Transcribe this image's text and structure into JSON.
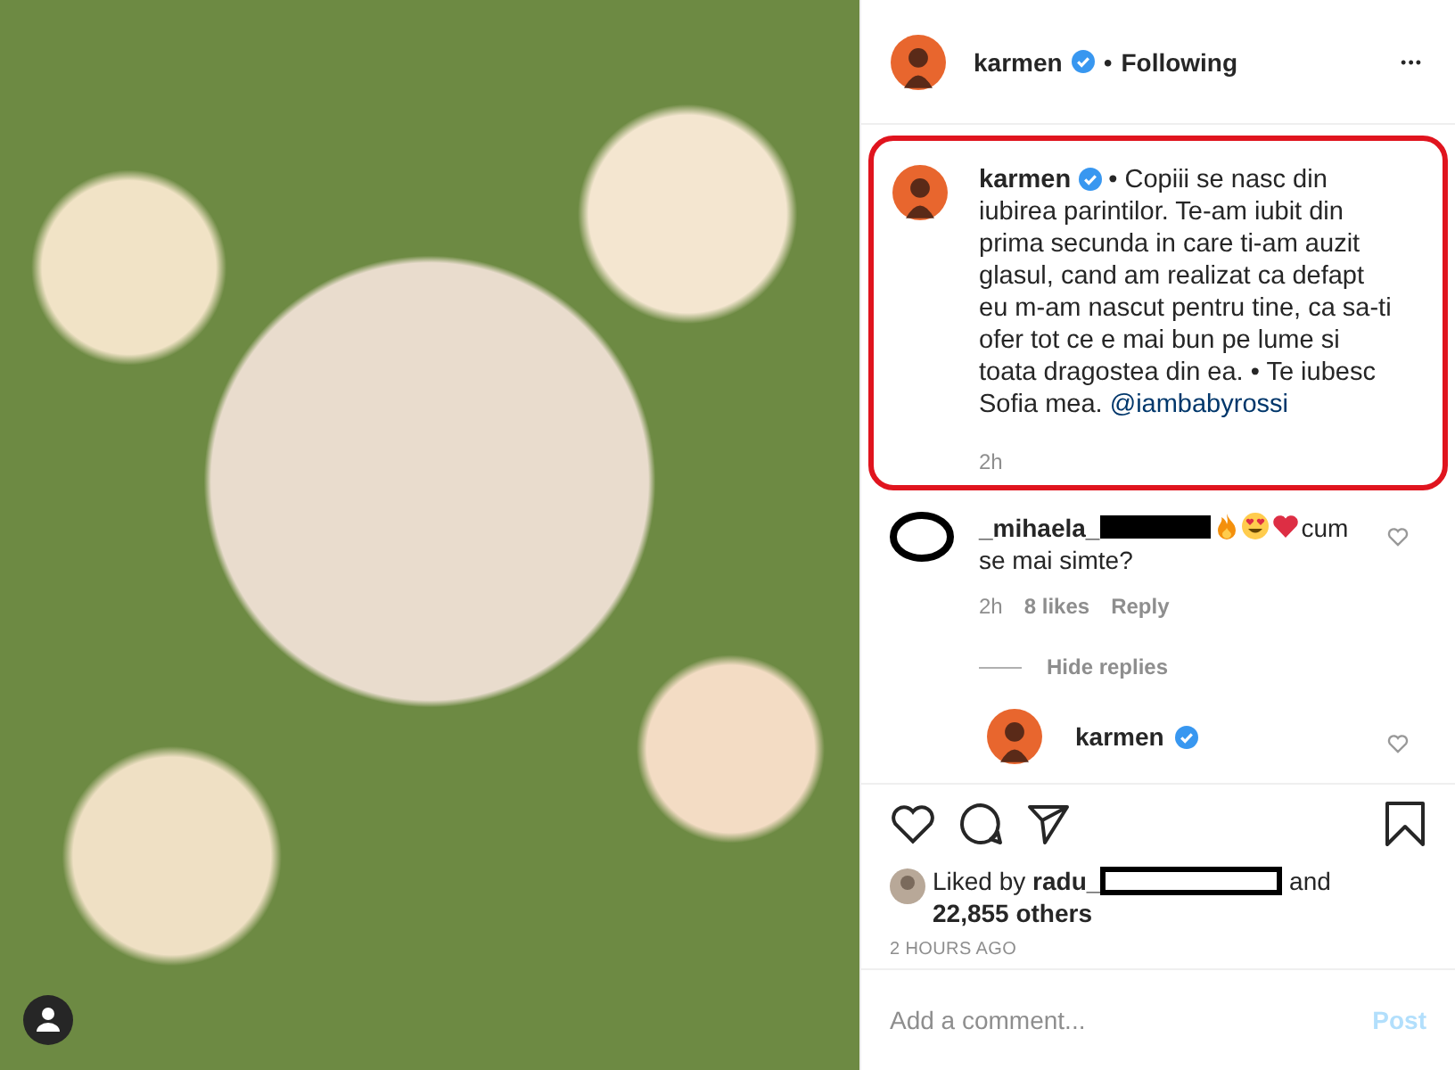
{
  "photo": {
    "tagged": true
  },
  "header": {
    "username": "karmen",
    "verified": true,
    "separator": "•",
    "follow_status": "Following",
    "more": "•••"
  },
  "caption": {
    "username": "karmen",
    "verified": true,
    "highlighted": true,
    "text": "• Copiii se nasc din iubirea parintilor. Te-am iubit din prima secunda in care ti-am auzit glasul, cand am realizat ca defapt eu m-am nascut pentru tine, ca sa-ti ofer tot ce e mai bun pe lume si toata dragostea din ea. • Te iubesc Sofia mea.",
    "mention": "@iambabyrossi",
    "time": "2h"
  },
  "comments": [
    {
      "username": "_mihaela_",
      "redacted": true,
      "emojis": [
        {
          "kind": "fire"
        },
        {
          "kind": "heart-eyes"
        },
        {
          "kind": "heart"
        }
      ],
      "text": "cum se mai simte?",
      "time": "2h",
      "likes": "8 likes",
      "reply": "Reply",
      "liked": false,
      "hide_replies": "Hide replies",
      "replies": [
        {
          "username": "karmen",
          "verified": true,
          "liked": false
        }
      ]
    }
  ],
  "actions": {
    "liked": false,
    "saved": false
  },
  "likes": {
    "prefix": "Liked by",
    "username": "radu_",
    "redacted": true,
    "suffix": "and",
    "others": "22,855 others"
  },
  "timestamp": "2 HOURS AGO",
  "comment_field": {
    "placeholder": "Add a comment...",
    "post_button": "Post",
    "disabled": true
  }
}
